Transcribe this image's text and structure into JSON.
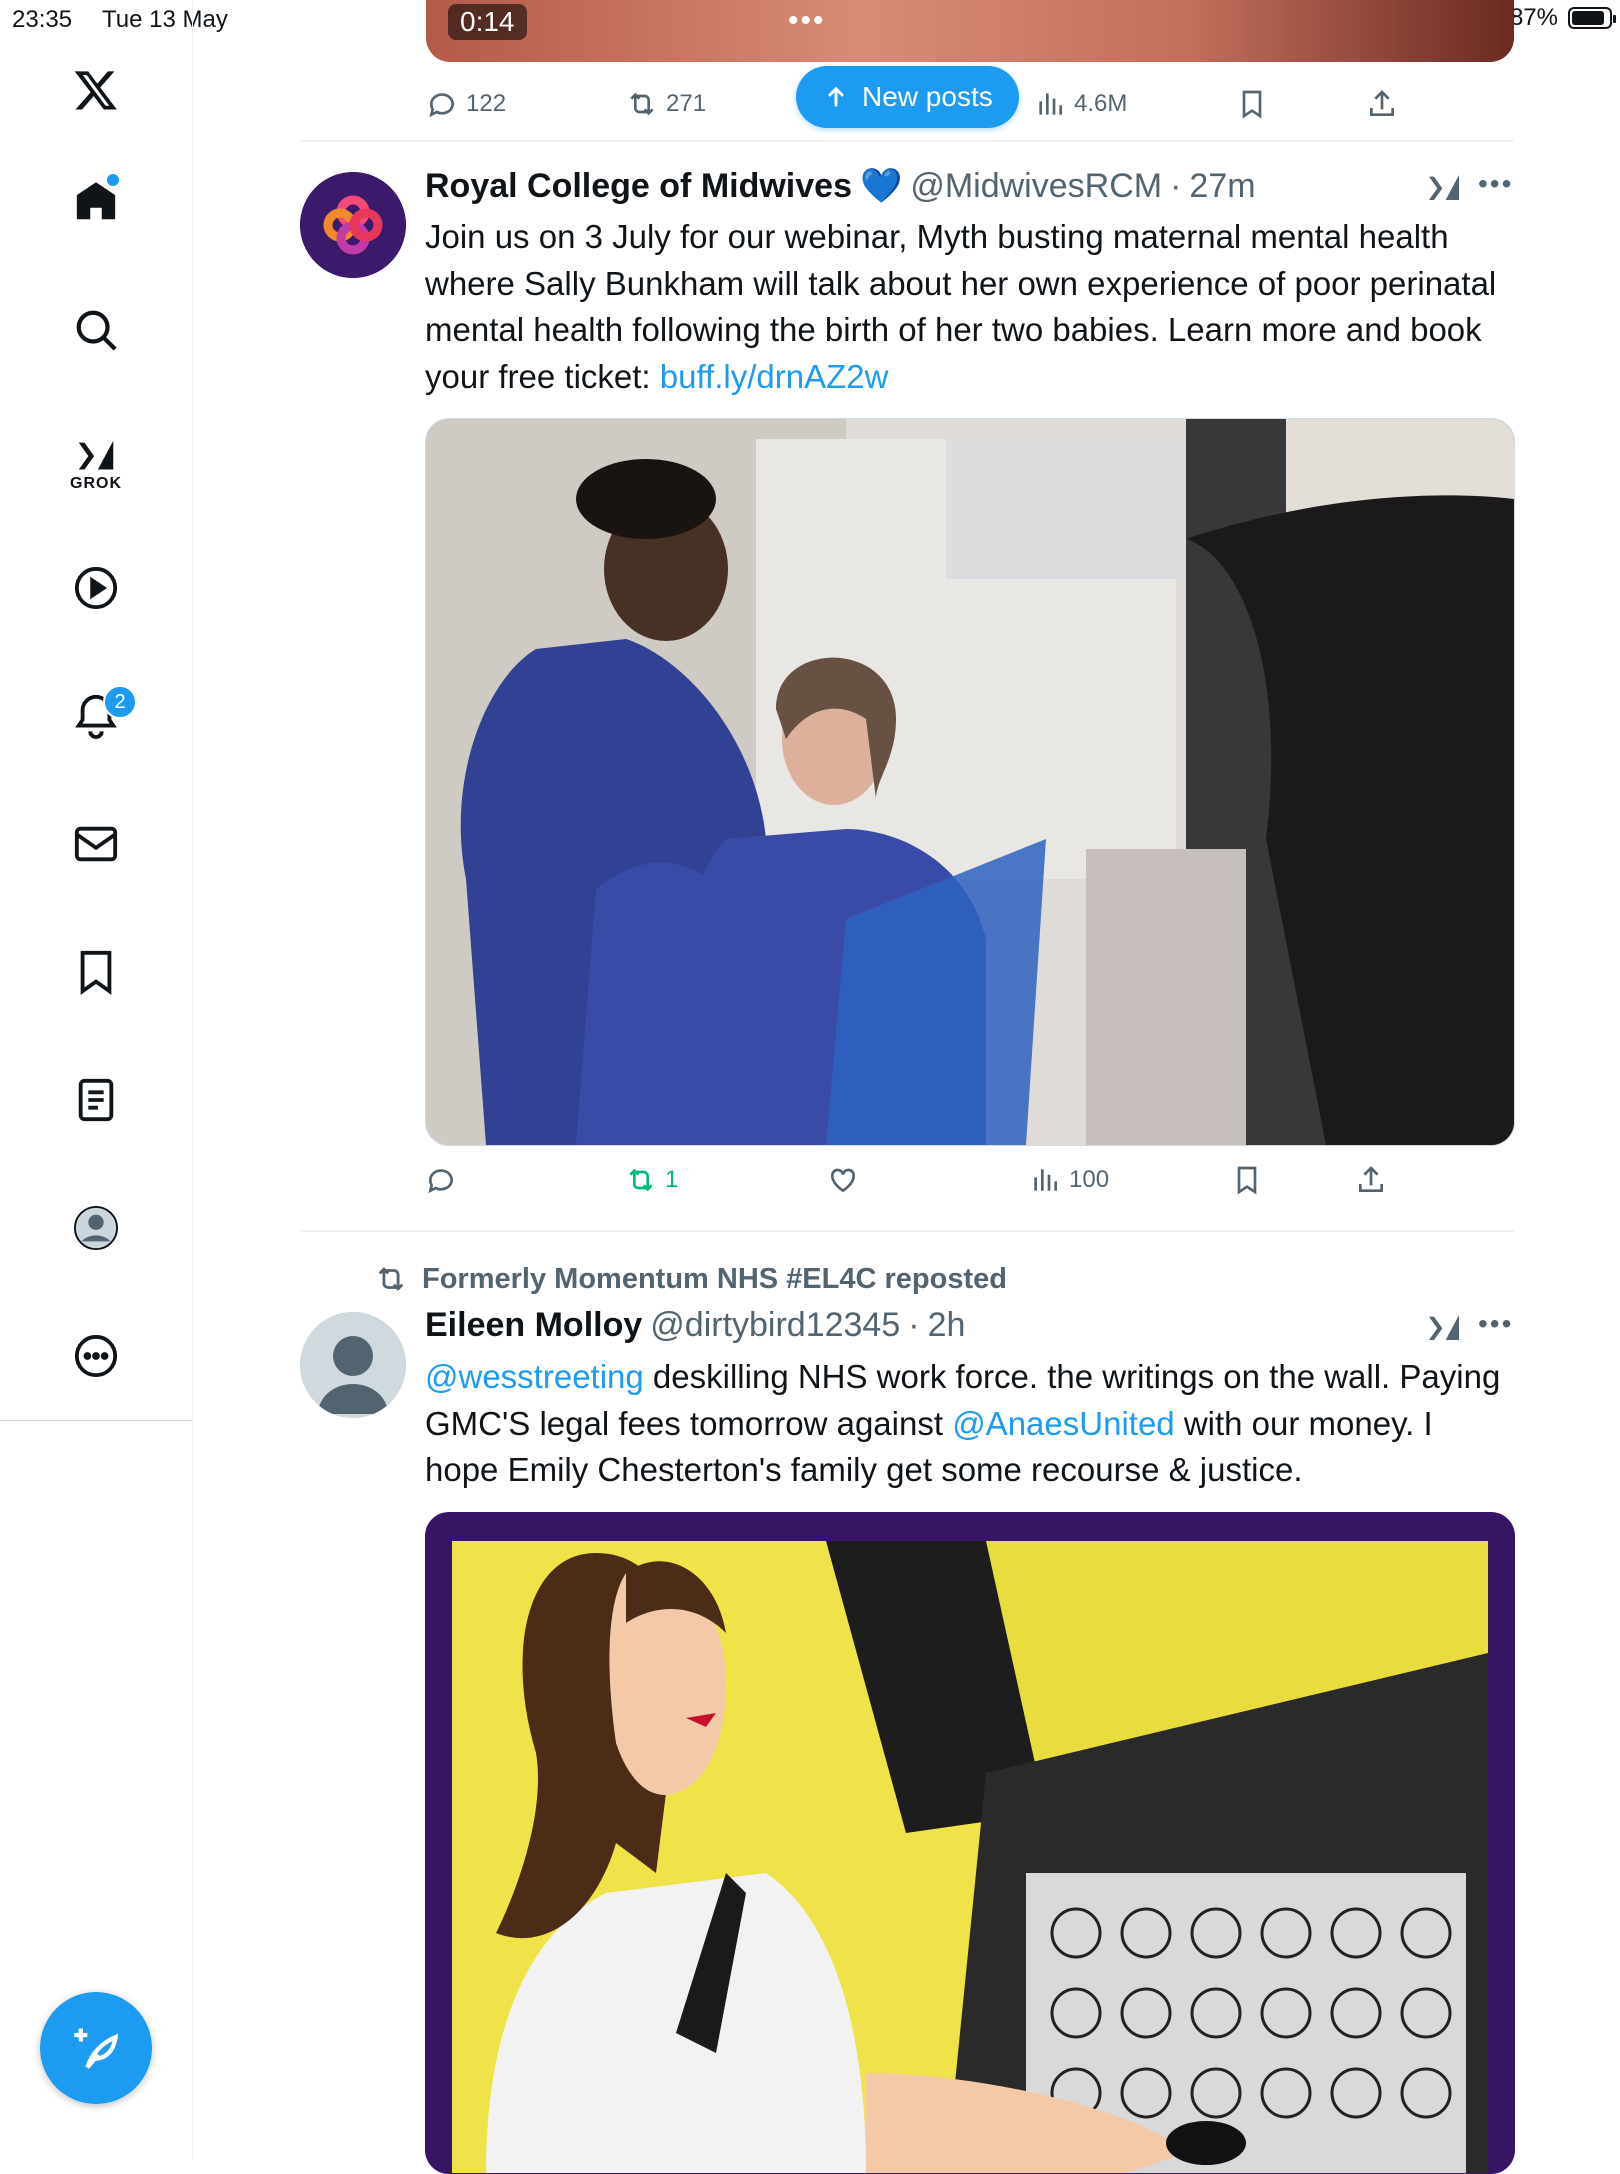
{
  "status_bar": {
    "time": "23:35",
    "date": "Tue 13 May",
    "battery": "87%"
  },
  "sidebar": {
    "grok_label": "GROK",
    "notifications_badge": "2"
  },
  "video_post": {
    "timestamp": "0:14",
    "replies": "122",
    "reposts": "271",
    "views": "4.6M"
  },
  "new_posts_label": "New posts",
  "post1": {
    "author": "Royal College of Midwives",
    "verified": "💙",
    "handle": "@MidwivesRCM",
    "sep": "·",
    "time": "27m",
    "text": "Join us on 3 July for our webinar, Myth busting maternal mental health where Sally Bunkham will talk about her own experience of poor perinatal mental health following the birth of her two babies. Learn more and book your free ticket: ",
    "link": "buff.ly/drnAZ2w",
    "reposts": "1",
    "views": "100"
  },
  "post2": {
    "repost_context": "Formerly Momentum NHS #EL4C reposted",
    "author": "Eileen Molloy",
    "handle": "@dirtybird12345",
    "sep": "·",
    "time": "2h",
    "mention1": "@wesstreeting",
    "text1": " deskilling NHS work force.  the writings on the wall. Paying GMC'S legal fees tomorrow against ",
    "mention2": "@AnaesUnited",
    "text2": " with our money. I hope Emily Chesterton's family get some recourse & justice."
  },
  "colors": {
    "accent": "#1d9bf0",
    "repost_green": "#00ba7c",
    "secondary_text": "#536471"
  }
}
